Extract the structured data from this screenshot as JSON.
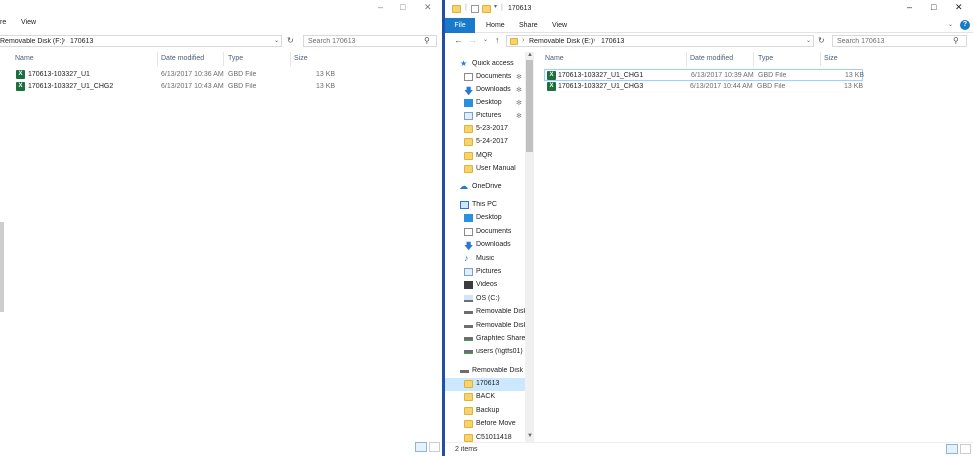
{
  "left": {
    "ribbon_tabs": [
      "re",
      "View"
    ],
    "address_path": [
      "Removable Disk (F:)",
      "170613"
    ],
    "search_placeholder": "Search 170613",
    "columns": [
      "Name",
      "Date modified",
      "Type",
      "Size"
    ],
    "files": [
      {
        "name": "170613-103327_U1",
        "date": "6/13/2017 10:36 AM",
        "type": "GBD File",
        "size": "13 KB"
      },
      {
        "name": "170613-103327_U1_CHG2",
        "date": "6/13/2017 10:43 AM",
        "type": "GBD File",
        "size": "13 KB"
      }
    ]
  },
  "right": {
    "title": "170613",
    "ribbon_tabs": [
      "File",
      "Home",
      "Share",
      "View"
    ],
    "address_path": [
      "Removable Disk (E:)",
      "170613"
    ],
    "search_placeholder": "Search 170613",
    "columns": [
      "Name",
      "Date modified",
      "Type",
      "Size"
    ],
    "files": [
      {
        "name": "170613-103327_U1_CHG1",
        "date": "6/13/2017 10:39 AM",
        "type": "GBD File",
        "size": "13 KB"
      },
      {
        "name": "170613-103327_U1_CHG3",
        "date": "6/13/2017 10:44 AM",
        "type": "GBD File",
        "size": "13 KB"
      }
    ],
    "nav": {
      "quick_access": "Quick access",
      "quick_items": [
        "Documents",
        "Downloads",
        "Desktop",
        "Pictures",
        "5-23-2017",
        "5-24-2017",
        "MQR",
        "User Manual"
      ],
      "onedrive": "OneDrive",
      "this_pc": "This PC",
      "pc_items": [
        "Desktop",
        "Documents",
        "Downloads",
        "Music",
        "Pictures",
        "Videos",
        "OS (C:)",
        "Removable Disk",
        "Removable Disk",
        "Graphtec Share (",
        "users (\\\\gtfs01) ("
      ],
      "removable": "Removable Disk (E",
      "removable_items": [
        "170613",
        "BACK",
        "Backup",
        "Before Move",
        "C51011418"
      ]
    },
    "status": "2 items"
  },
  "colors": {
    "accent": "#1979ca",
    "divider": "#1f4fa8",
    "selection": "#cce8ff",
    "excel": "#1d6f3e"
  }
}
